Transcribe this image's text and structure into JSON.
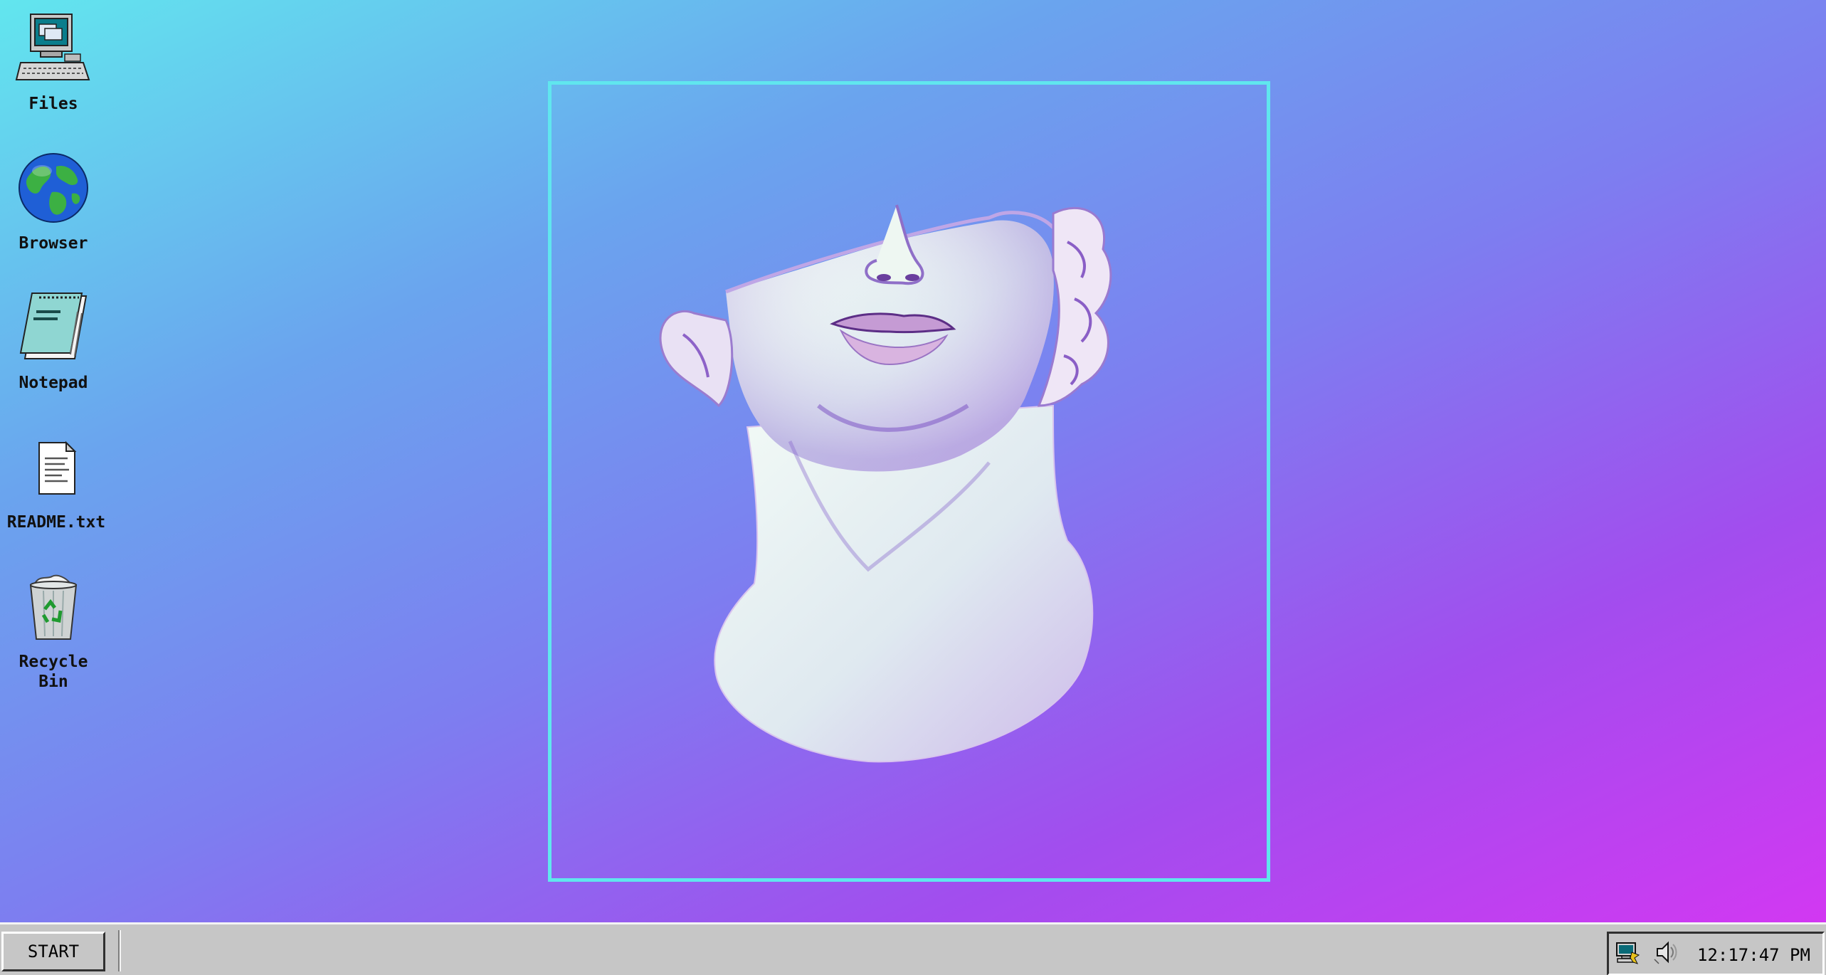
{
  "desktop": {
    "icons": [
      {
        "label": "Files",
        "icon": "computer-icon"
      },
      {
        "label": "Browser",
        "icon": "globe-icon"
      },
      {
        "label": "Notepad",
        "icon": "notepad-icon"
      },
      {
        "label": "README.txt",
        "icon": "text-file-icon"
      },
      {
        "label": "Recycle\nBin",
        "icon": "recycle-bin-icon"
      }
    ],
    "wallpaper": {
      "gradient_colors": [
        "#62e6ee",
        "#6aa4ee",
        "#7d7ef0",
        "#a24dee",
        "#d238f2"
      ],
      "frame_color": "#60e6ee",
      "subject": "statue-head-image"
    }
  },
  "taskbar": {
    "start_label": "START",
    "tray": {
      "icons": [
        "network-icon",
        "speaker-icon"
      ],
      "clock": "12:17:47 PM"
    }
  }
}
